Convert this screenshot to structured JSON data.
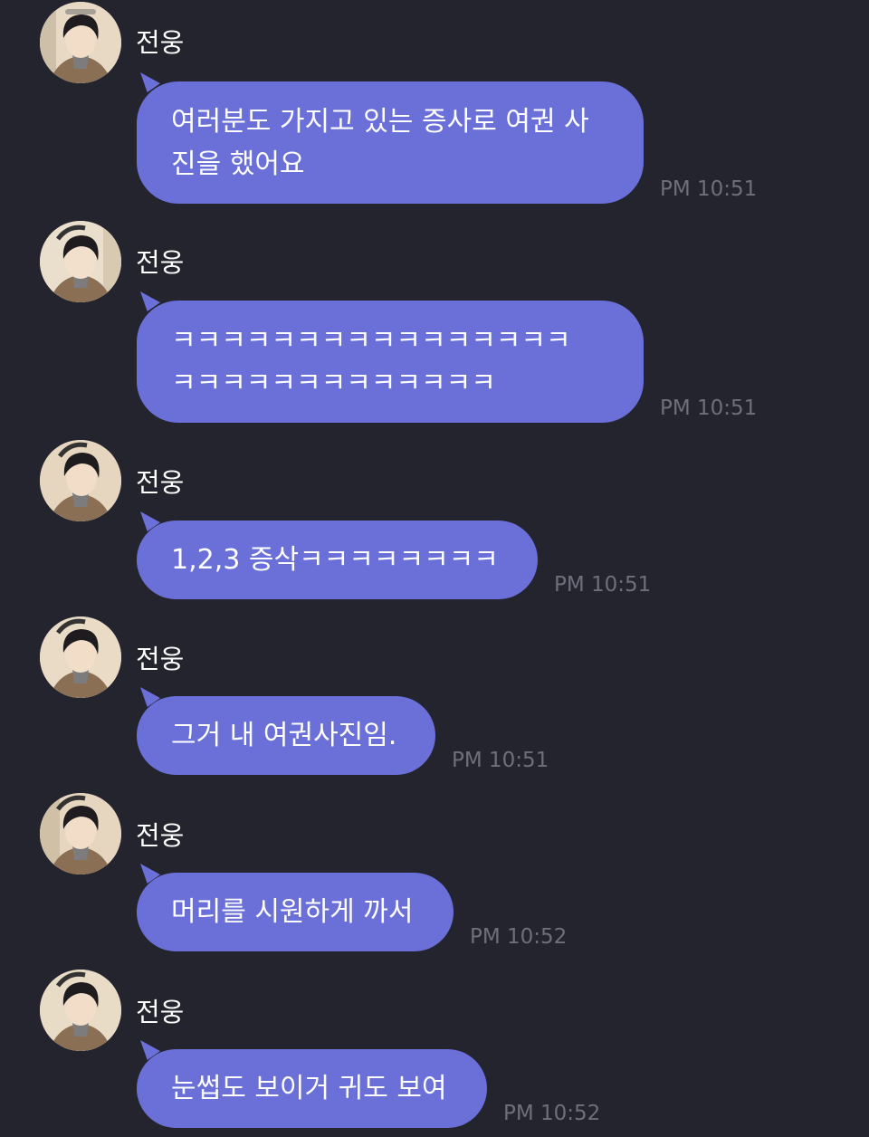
{
  "messages": [
    {
      "sender": "전웅",
      "lines": [
        "여러분도 가지고 있는 증사로 여권 사",
        "진을 했어요"
      ],
      "time": "PM 10:51"
    },
    {
      "sender": "전웅",
      "lines": [
        "ㅋㅋㅋㅋㅋㅋㅋㅋㅋㅋㅋㅋㅋㅋㅋㅋ",
        "ㅋㅋㅋㅋㅋㅋㅋㅋㅋㅋㅋㅋㅋ"
      ],
      "time": "PM 10:51"
    },
    {
      "sender": "전웅",
      "lines": [
        "1,2,3 증삭ㅋㅋㅋㅋㅋㅋㅋㅋ"
      ],
      "time": "PM 10:51"
    },
    {
      "sender": "전웅",
      "lines": [
        "그거 내 여권사진임."
      ],
      "time": "PM 10:51"
    },
    {
      "sender": "전웅",
      "lines": [
        "머리를 시원하게 까서"
      ],
      "time": "PM 10:52"
    },
    {
      "sender": "전웅",
      "lines": [
        "눈썹도 보이거 귀도 보여"
      ],
      "time": "PM 10:52"
    }
  ],
  "colors": {
    "background": "#24242f",
    "bubble": "#6b70d9",
    "sender_text": "#ffffff",
    "timestamp": "#6f6f7c"
  },
  "icons": {
    "avatar": "profile-photo"
  }
}
